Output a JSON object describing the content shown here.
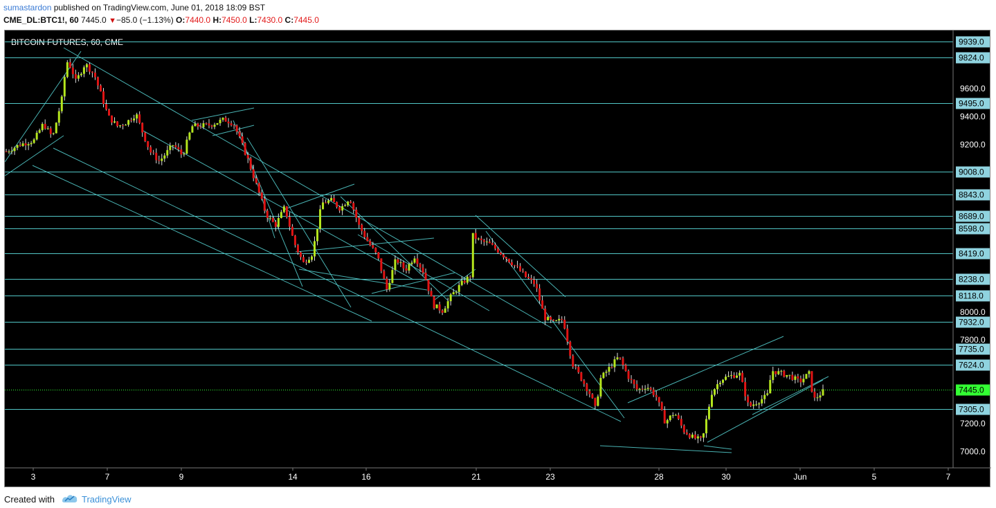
{
  "header": {
    "user": "sumastardon",
    "published": " published on TradingView.com, June 01, 2018 18:09 BST",
    "symbol": "CME_DL:BTC1!, 60",
    "last": "7445.0",
    "change": "−85.0 (−1.13%)",
    "o_label": "O:",
    "o_val": "7440.0",
    "h_label": "H:",
    "h_val": "7450.0",
    "l_label": "L:",
    "l_val": "7430.0",
    "c_label": "C:",
    "c_val": "7445.0"
  },
  "chart_title": "BITCOIN FUTURES, 60, CME",
  "chart_data": {
    "type": "candlestick",
    "title": "BITCOIN FUTURES, 60, CME",
    "y_range": [
      6900,
      9980
    ],
    "y_ticks": [
      "9600.0",
      "9400.0",
      "9200.0",
      "8000.0",
      "7800.0",
      "7200.0",
      "7000.0"
    ],
    "x_ticks": [
      "3",
      "7",
      "9",
      "14",
      "16",
      "21",
      "23",
      "28",
      "30",
      "Jun",
      "5",
      "7"
    ],
    "price_levels": [
      "9939.0",
      "9824.0",
      "9495.0",
      "9008.0",
      "8843.0",
      "8689.0",
      "8598.0",
      "8419.0",
      "8238.0",
      "8118.0",
      "7932.0",
      "7735.0",
      "7624.0",
      "7305.0"
    ],
    "current_price": "7445.0",
    "price_path": [
      [
        0,
        9150
      ],
      [
        3,
        9200
      ],
      [
        6,
        9230
      ],
      [
        8,
        9350
      ],
      [
        10,
        9250
      ],
      [
        12,
        9530
      ],
      [
        13,
        9800
      ],
      [
        14,
        9750
      ],
      [
        15,
        9650
      ],
      [
        17,
        9780
      ],
      [
        19,
        9700
      ],
      [
        22,
        9400
      ],
      [
        24,
        9330
      ],
      [
        26,
        9360
      ],
      [
        28,
        9420
      ],
      [
        29,
        9320
      ],
      [
        31,
        9150
      ],
      [
        33,
        9080
      ],
      [
        36,
        9200
      ],
      [
        38,
        9120
      ],
      [
        40,
        9330
      ],
      [
        44,
        9340
      ],
      [
        47,
        9380
      ],
      [
        49,
        9350
      ],
      [
        52,
        9100
      ],
      [
        54,
        8900
      ],
      [
        56,
        8700
      ],
      [
        58,
        8620
      ],
      [
        60,
        8750
      ],
      [
        62,
        8500
      ],
      [
        64,
        8350
      ],
      [
        66,
        8420
      ],
      [
        68,
        8780
      ],
      [
        70,
        8800
      ],
      [
        72,
        8740
      ],
      [
        74,
        8820
      ],
      [
        76,
        8620
      ],
      [
        78,
        8500
      ],
      [
        80,
        8400
      ],
      [
        82,
        8160
      ],
      [
        84,
        8380
      ],
      [
        86,
        8300
      ],
      [
        88,
        8400
      ],
      [
        90,
        8280
      ],
      [
        92,
        8050
      ],
      [
        94,
        8010
      ],
      [
        96,
        8120
      ],
      [
        98,
        8200
      ],
      [
        100,
        8260
      ],
      [
        100.5,
        8550
      ],
      [
        102,
        8510
      ],
      [
        104,
        8490
      ],
      [
        106,
        8440
      ],
      [
        108,
        8380
      ],
      [
        110,
        8320
      ],
      [
        112,
        8250
      ],
      [
        114,
        8200
      ],
      [
        116,
        7960
      ],
      [
        118,
        7920
      ],
      [
        120,
        7950
      ],
      [
        122,
        7630
      ],
      [
        124,
        7520
      ],
      [
        126,
        7400
      ],
      [
        127,
        7300
      ],
      [
        128,
        7520
      ],
      [
        130,
        7600
      ],
      [
        132,
        7680
      ],
      [
        134,
        7540
      ],
      [
        136,
        7440
      ],
      [
        138,
        7470
      ],
      [
        140,
        7400
      ],
      [
        142,
        7210
      ],
      [
        144,
        7280
      ],
      [
        146,
        7150
      ],
      [
        148,
        7100
      ],
      [
        150,
        7080
      ],
      [
        152,
        7420
      ],
      [
        154,
        7520
      ],
      [
        156,
        7540
      ],
      [
        158,
        7560
      ],
      [
        160,
        7320
      ],
      [
        162,
        7360
      ],
      [
        164,
        7400
      ],
      [
        165,
        7580
      ],
      [
        167,
        7560
      ],
      [
        169,
        7540
      ],
      [
        171,
        7500
      ],
      [
        173,
        7560
      ],
      [
        174,
        7370
      ],
      [
        176,
        7430
      ]
    ]
  },
  "footer": {
    "created_with": "Created with",
    "brand": "TradingView"
  },
  "colors": {
    "up": "#b5e61d",
    "down": "#e11414",
    "level_line": "#52c7c7",
    "price_label_bg": "#8fd3df",
    "current_label_bg": "#33ff33"
  }
}
